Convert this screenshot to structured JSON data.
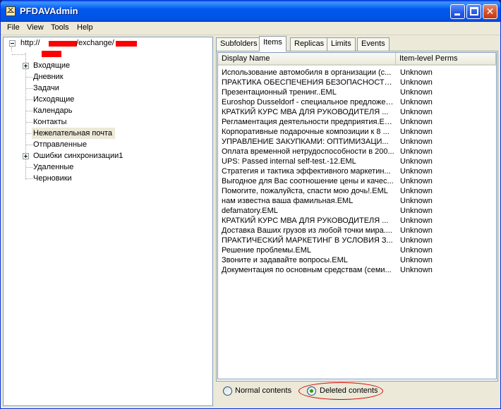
{
  "window": {
    "title": "PFDAVAdmin",
    "icon": "envelope-icon",
    "controls": [
      "minimize-icon",
      "maximize-icon",
      "close-icon"
    ],
    "close_glyph": "✕"
  },
  "menu": {
    "items": [
      "File",
      "View",
      "Tools",
      "Help"
    ]
  },
  "tree": {
    "root_prefix": "http://",
    "root_middle": "/exchange/",
    "root_expanded": true,
    "items": [
      {
        "label": "Входящие",
        "expandable": true
      },
      {
        "label": "Дневник",
        "expandable": false
      },
      {
        "label": "Задачи",
        "expandable": false
      },
      {
        "label": "Исходящие",
        "expandable": false
      },
      {
        "label": "Календарь",
        "expandable": false
      },
      {
        "label": "Контакты",
        "expandable": false
      },
      {
        "label": "Нежелательная почта",
        "expandable": false,
        "selected": true
      },
      {
        "label": "Отправленные",
        "expandable": false
      },
      {
        "label": "Ошибки синхронизации1",
        "expandable": true
      },
      {
        "label": "Удаленные",
        "expandable": false
      },
      {
        "label": "Черновики",
        "expandable": false
      }
    ]
  },
  "tabs": [
    {
      "label": "Subfolders",
      "active": false
    },
    {
      "label": "Items",
      "active": true
    },
    {
      "label": "Replicas",
      "active": false
    },
    {
      "label": "Limits",
      "active": false
    },
    {
      "label": "Events",
      "active": false
    }
  ],
  "table": {
    "columns": [
      "Display Name",
      "Item-level Perms"
    ],
    "rows": [
      {
        "name": "Использование автомобиля в организации (с...",
        "perms": "Unknown"
      },
      {
        "name": "ПРАКТИКА ОБЕСПЕЧЕНИЯ БЕЗОПАСНОСТИ...",
        "perms": "Unknown"
      },
      {
        "name": "Презентационный тренинг..EML",
        "perms": "Unknown"
      },
      {
        "name": "Euroshop Dusseldorf - специальное предложен...",
        "perms": "Unknown"
      },
      {
        "name": "КРАТКИЙ КУРС МВА ДЛЯ РУКОВОДИТЕЛЯ ...",
        "perms": "Unknown"
      },
      {
        "name": "Регламентация деятельности предприятия.EML",
        "perms": "Unknown"
      },
      {
        "name": "Корпоративные подарочные композиции к 8 ...",
        "perms": "Unknown"
      },
      {
        "name": "УПРАВЛЕНИЕ ЗАКУПКАМИ: ОПТИМИЗАЦИ...",
        "perms": "Unknown"
      },
      {
        "name": "Оплата временной нетрудоспособности в 200...",
        "perms": "Unknown"
      },
      {
        "name": "UPS: Passed internal self-test.-12.EML",
        "perms": "Unknown"
      },
      {
        "name": "Стратегия и тактика эффективного маркетин...",
        "perms": "Unknown"
      },
      {
        "name": "Выгодное для Вас соотношение цены и качес...",
        "perms": "Unknown"
      },
      {
        "name": "Помогите, пожалуйста, спасти мою дочь!.EML",
        "perms": "Unknown"
      },
      {
        "name": "нам известна ваша фамильная.EML",
        "perms": "Unknown"
      },
      {
        "name": "defamatory.EML",
        "perms": "Unknown"
      },
      {
        "name": "КРАТКИЙ КУРС МВА ДЛЯ РУКОВОДИТЕЛЯ ...",
        "perms": "Unknown"
      },
      {
        "name": "Доставка Ваших грузов из любой точки мира....",
        "perms": "Unknown"
      },
      {
        "name": "ПРАКТИЧЕСКИЙ МАРКЕТИНГ В УСЛОВИЯ З...",
        "perms": "Unknown"
      },
      {
        "name": "Решение проблемы.EML",
        "perms": "Unknown"
      },
      {
        "name": "Звоните и задавайте вопросы.EML",
        "perms": "Unknown"
      },
      {
        "name": "Документация по основным средствам (семи...",
        "perms": "Unknown"
      }
    ]
  },
  "view_options": {
    "normal_label": "Normal contents",
    "deleted_label": "Deleted contents",
    "selected": "deleted"
  },
  "colors": {
    "titlebar": "#0054e3",
    "window_face": "#ece9d8",
    "redaction": "#ff0000",
    "annotation": "#d40000"
  }
}
